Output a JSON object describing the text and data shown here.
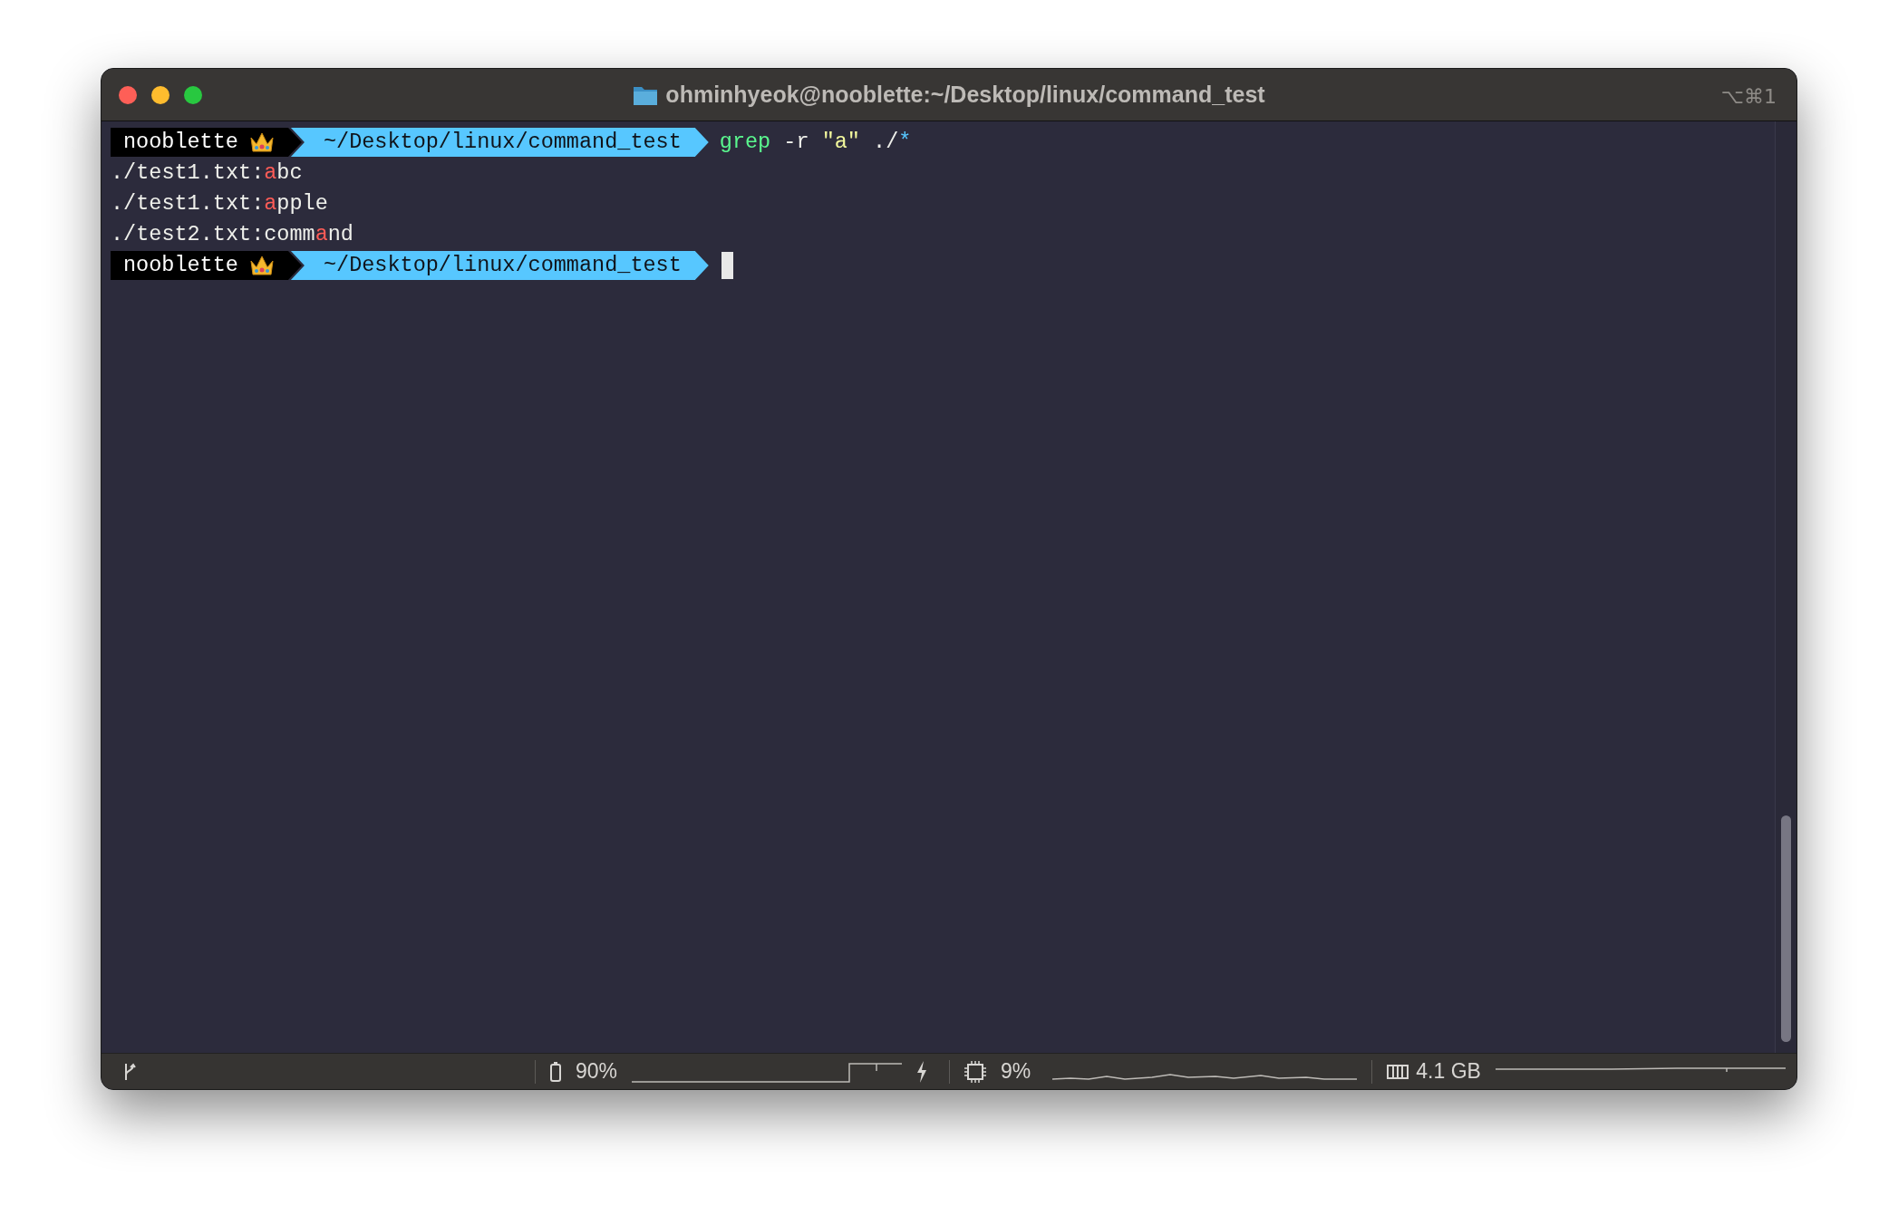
{
  "window": {
    "title": "ohminhyeok@nooblette:~/Desktop/linux/command_test",
    "shortcut": "⌥⌘1"
  },
  "terminal": {
    "lines": [
      {
        "kind": "prompt",
        "user": "nooblette",
        "path": "~/Desktop/linux/command_test",
        "cursor": false,
        "command": [
          {
            "kind": "program",
            "text": "grep"
          },
          {
            "kind": "plain",
            "text": " -r "
          },
          {
            "kind": "string",
            "text": "\"a\""
          },
          {
            "kind": "plain",
            "text": " ./"
          },
          {
            "kind": "glob",
            "text": "*"
          }
        ]
      },
      {
        "kind": "output",
        "segments": [
          {
            "text": "./test1.txt:",
            "match": false
          },
          {
            "text": "a",
            "match": true
          },
          {
            "text": "bc",
            "match": false
          }
        ]
      },
      {
        "kind": "output",
        "segments": [
          {
            "text": "./test1.txt:",
            "match": false
          },
          {
            "text": "a",
            "match": true
          },
          {
            "text": "pple",
            "match": false
          }
        ]
      },
      {
        "kind": "output",
        "segments": [
          {
            "text": "./test2.txt:comm",
            "match": false
          },
          {
            "text": "a",
            "match": true
          },
          {
            "text": "nd",
            "match": false
          }
        ]
      },
      {
        "kind": "prompt",
        "user": "nooblette",
        "path": "~/Desktop/linux/command_test",
        "cursor": true
      }
    ]
  },
  "status_bar": {
    "battery": "90%",
    "cpu": "9%",
    "memory": "4.1 GB"
  }
}
